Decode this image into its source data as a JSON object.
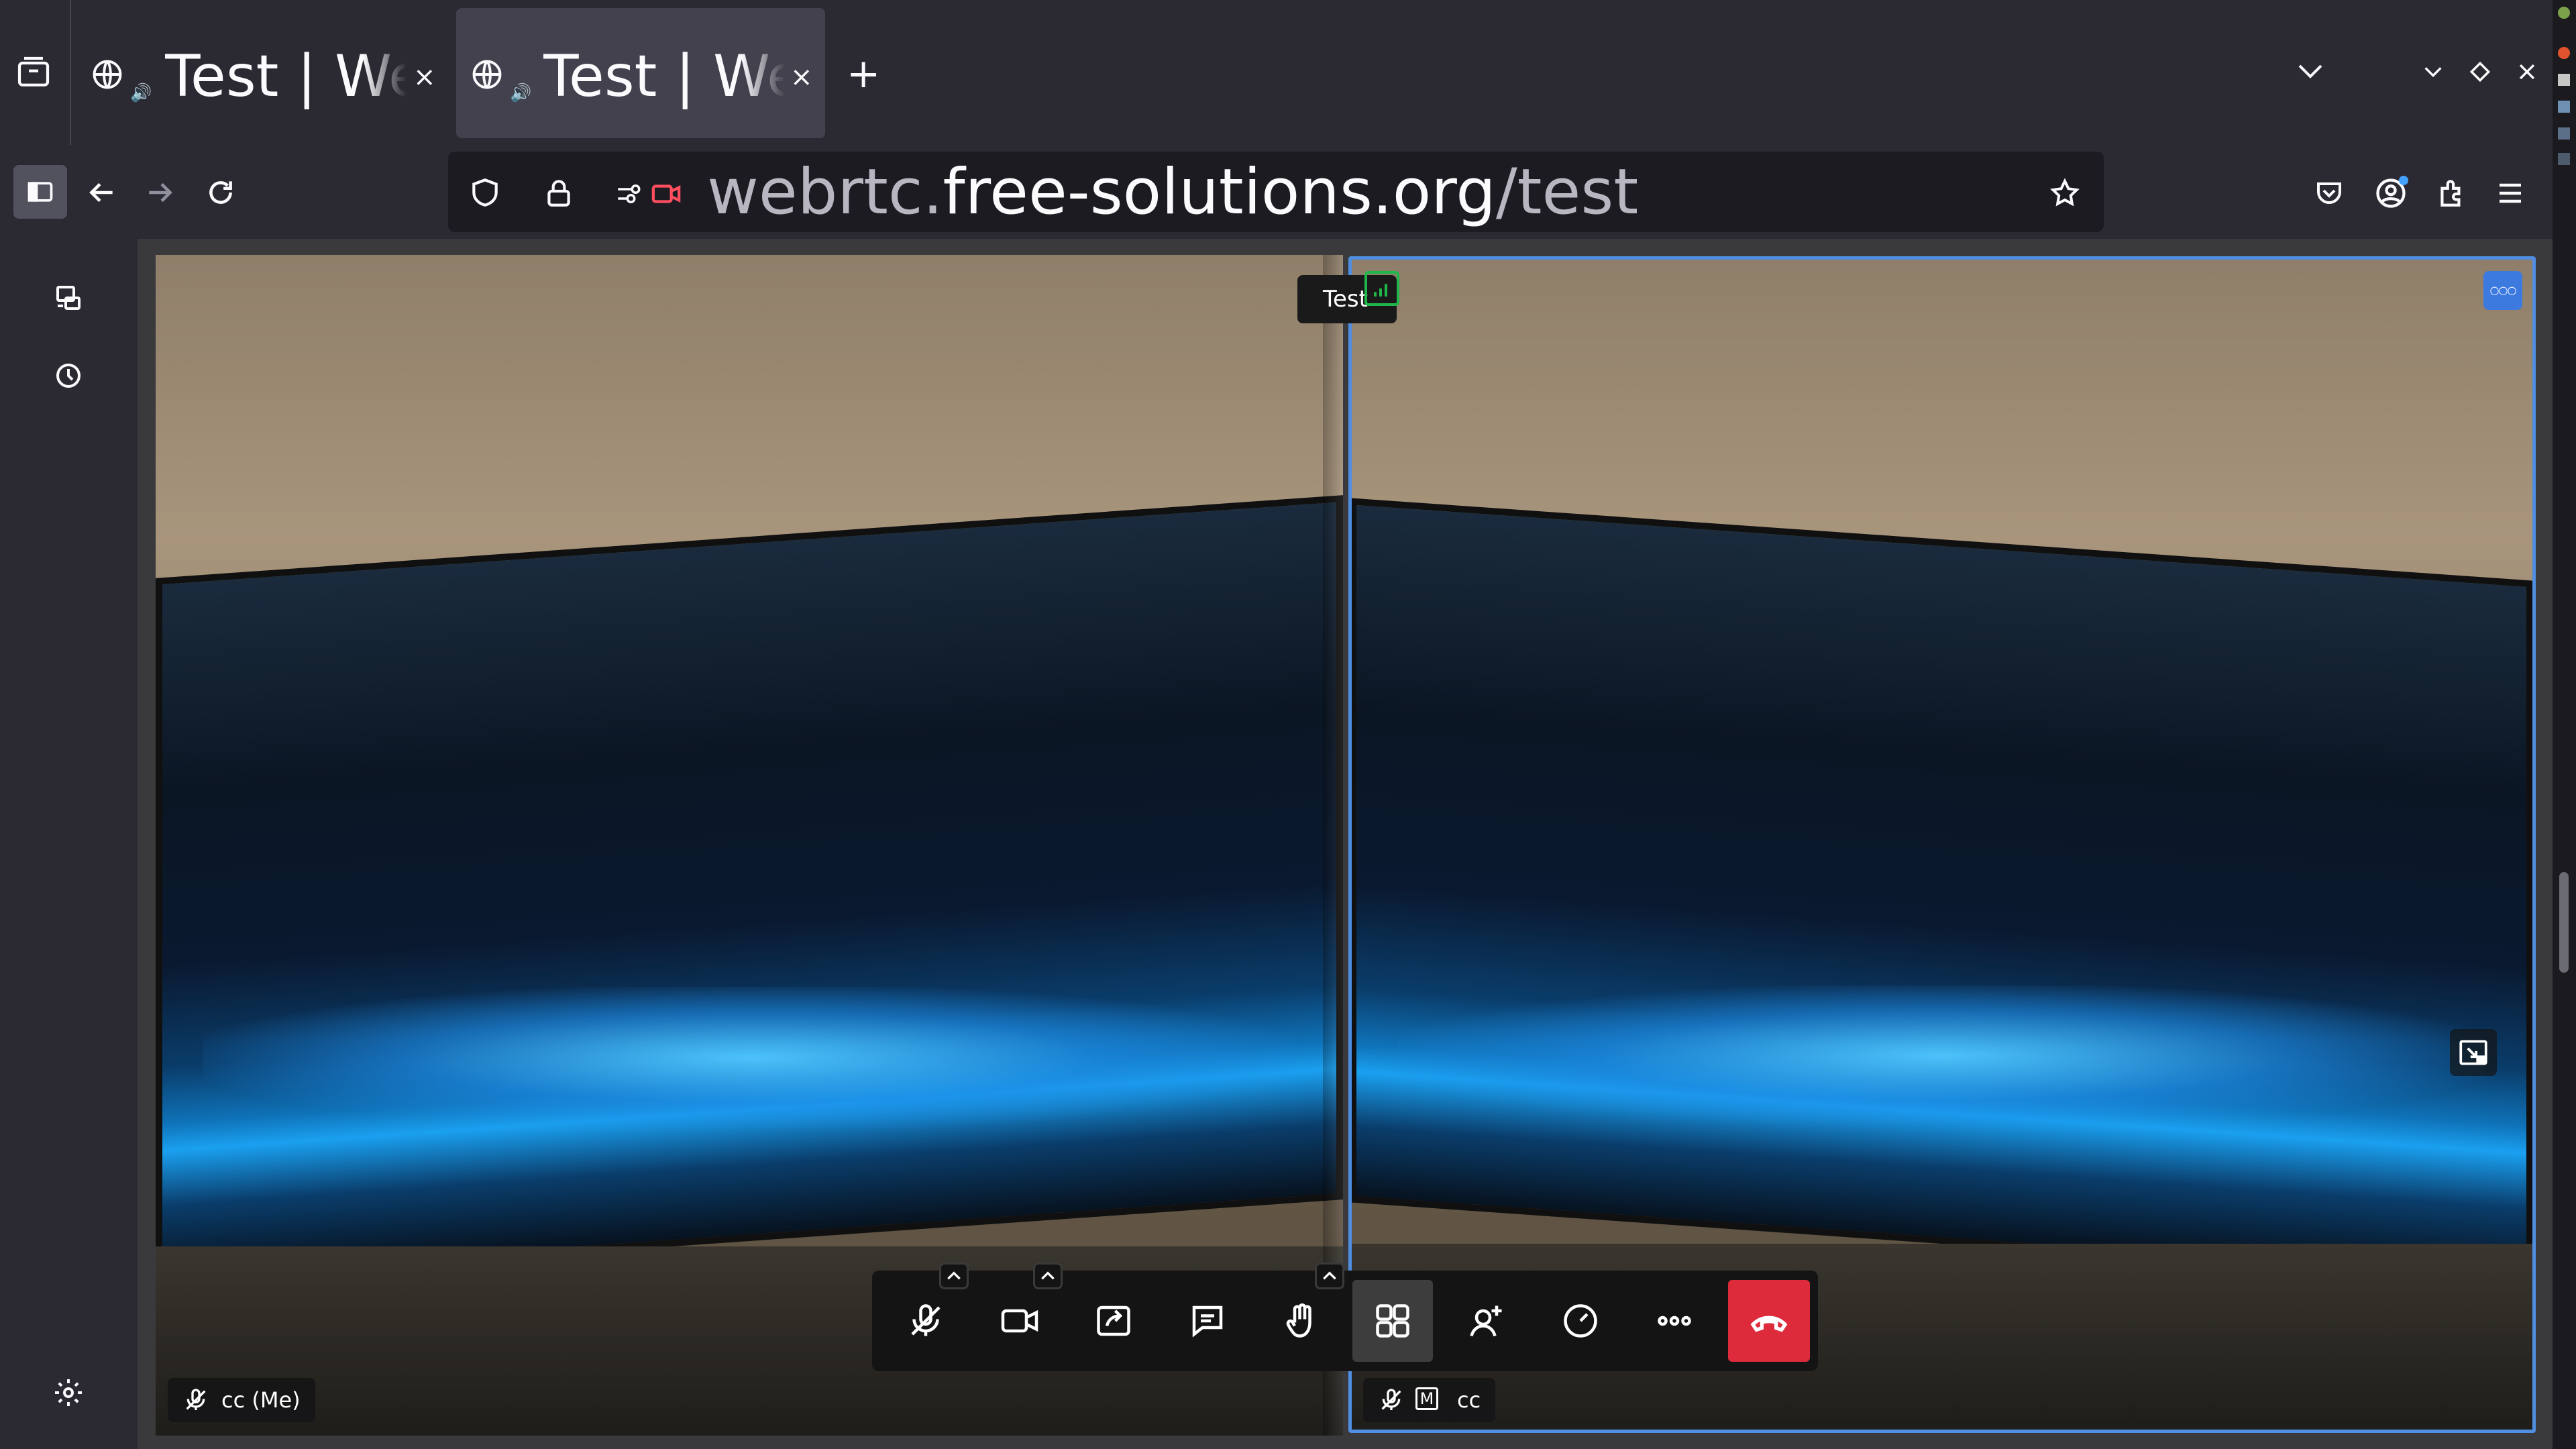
{
  "browser": {
    "tabs": [
      {
        "title": "Test | We",
        "active": false
      },
      {
        "title": "Test | We",
        "active": true
      }
    ],
    "new_tab_label": "+",
    "close_glyph": "×",
    "url": {
      "prefix": "webrtc.",
      "domain": "free-solutions.org",
      "path": "/test"
    }
  },
  "meeting": {
    "room_name": "Test",
    "local_participant": "cc (Me)",
    "remote_participant": "cc",
    "moderator_badge": "M",
    "options_glyph": "○○○",
    "colors": {
      "hangup": "#dd2b3c",
      "speaker_outline": "#4f8ee0",
      "signal": "#1fb64a",
      "options_button": "#3d7ae0"
    }
  },
  "icons": [
    "tab-overview-icon",
    "globe-icon",
    "speaker-icon",
    "chevron-down-icon",
    "sidebar-toggle-icon",
    "back-arrow-icon",
    "forward-arrow-icon",
    "reload-icon",
    "shield-icon",
    "lock-icon",
    "permissions-icon",
    "camera-sharing-icon",
    "star-icon",
    "pocket-icon",
    "account-icon",
    "extensions-icon",
    "menu-icon",
    "synced-tabs-icon",
    "history-icon",
    "settings-icon",
    "mic-muted-icon",
    "camera-icon",
    "screen-share-icon",
    "chat-icon",
    "raise-hand-icon",
    "tile-view-icon",
    "invite-icon",
    "performance-icon",
    "more-icon",
    "hangup-icon"
  ]
}
